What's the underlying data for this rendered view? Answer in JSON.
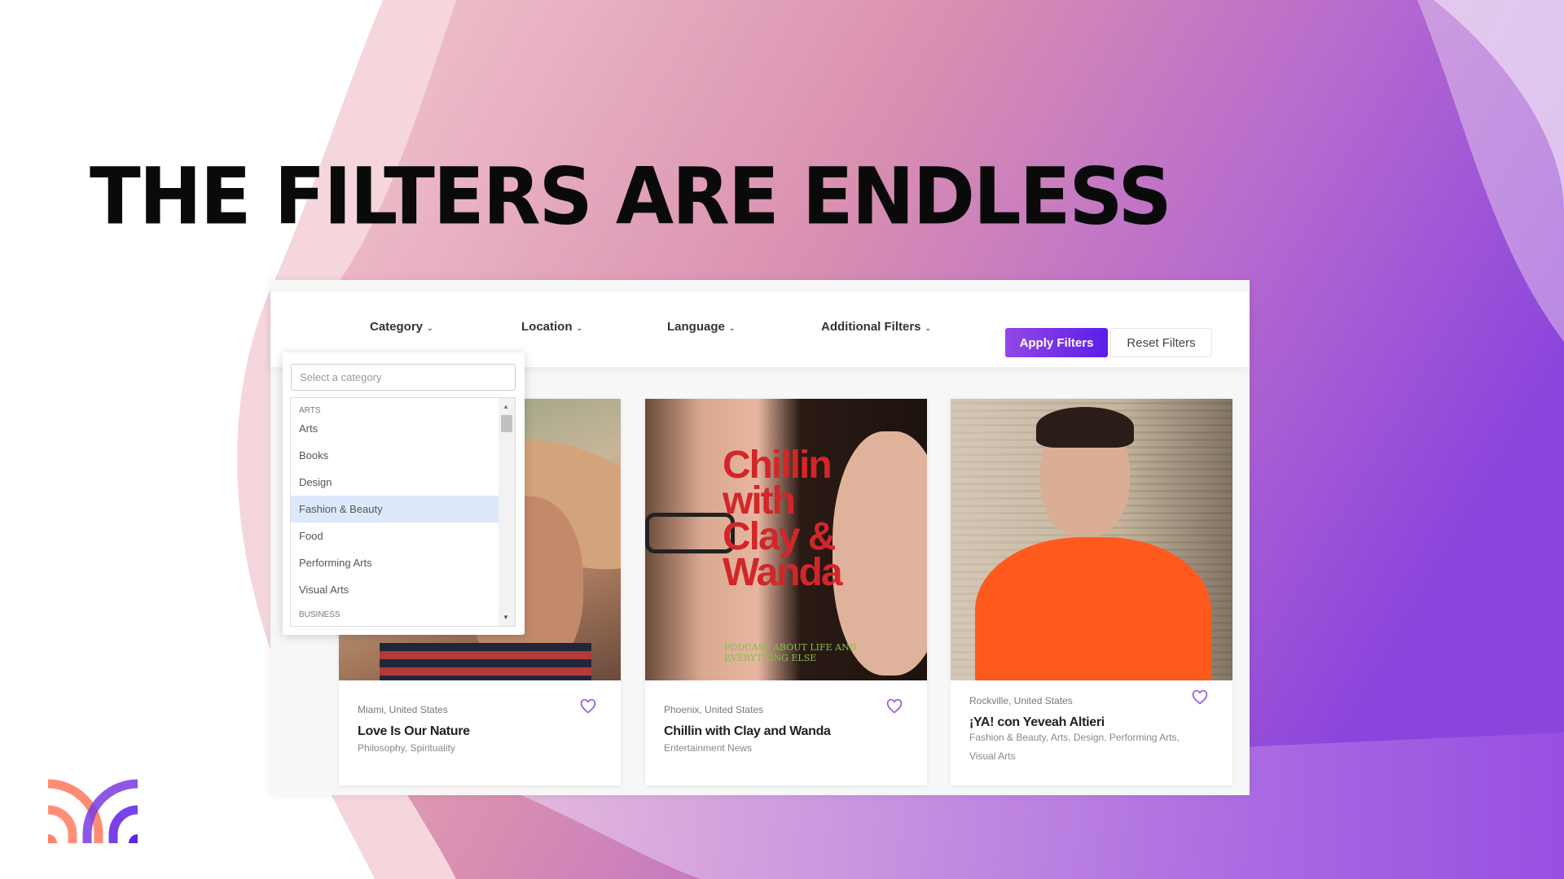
{
  "headline": "THE FILTERS ARE ENDLESS",
  "colors": {
    "accent": "#7b2ff0",
    "apply_start": "#9447e6",
    "apply_end": "#5a1ee8",
    "highlight": "#dde9fb",
    "heart": "#9b59e0"
  },
  "filters": [
    {
      "label": "Category"
    },
    {
      "label": "Location"
    },
    {
      "label": "Language"
    },
    {
      "label": "Additional Filters"
    }
  ],
  "apply_label": "Apply Filters",
  "reset_label": "Reset Filters",
  "category_dropdown": {
    "placeholder": "Select a category",
    "groups": [
      {
        "label": "ARTS"
      },
      {
        "label": "BUSINESS"
      }
    ],
    "options": [
      {
        "label": "Arts"
      },
      {
        "label": "Books"
      },
      {
        "label": "Design"
      },
      {
        "label": "Fashion & Beauty",
        "highlighted": true
      },
      {
        "label": "Food"
      },
      {
        "label": "Performing Arts"
      },
      {
        "label": "Visual Arts"
      }
    ]
  },
  "cards": [
    {
      "location": "Miami, United States",
      "title": "Love Is Our Nature",
      "tags": "Philosophy, Spirituality",
      "icon": "heart-outline-icon"
    },
    {
      "location": "Phoenix, United States",
      "title": "Chillin with Clay and Wanda",
      "tags": "Entertainment News",
      "icon": "heart-outline-icon",
      "cover_text": [
        "Chillin",
        "with",
        "Clay &",
        "Wanda"
      ],
      "cover_sub": "PODCAST ABOUT LIFE AND EVERYTHING ELSE"
    },
    {
      "location": "Rockville, United States",
      "title": "¡YA! con Yeveah Altieri",
      "tags": "Fashion & Beauty, Arts, Design, Performing Arts, Visual Arts",
      "icon": "heart-outline-icon"
    }
  ]
}
